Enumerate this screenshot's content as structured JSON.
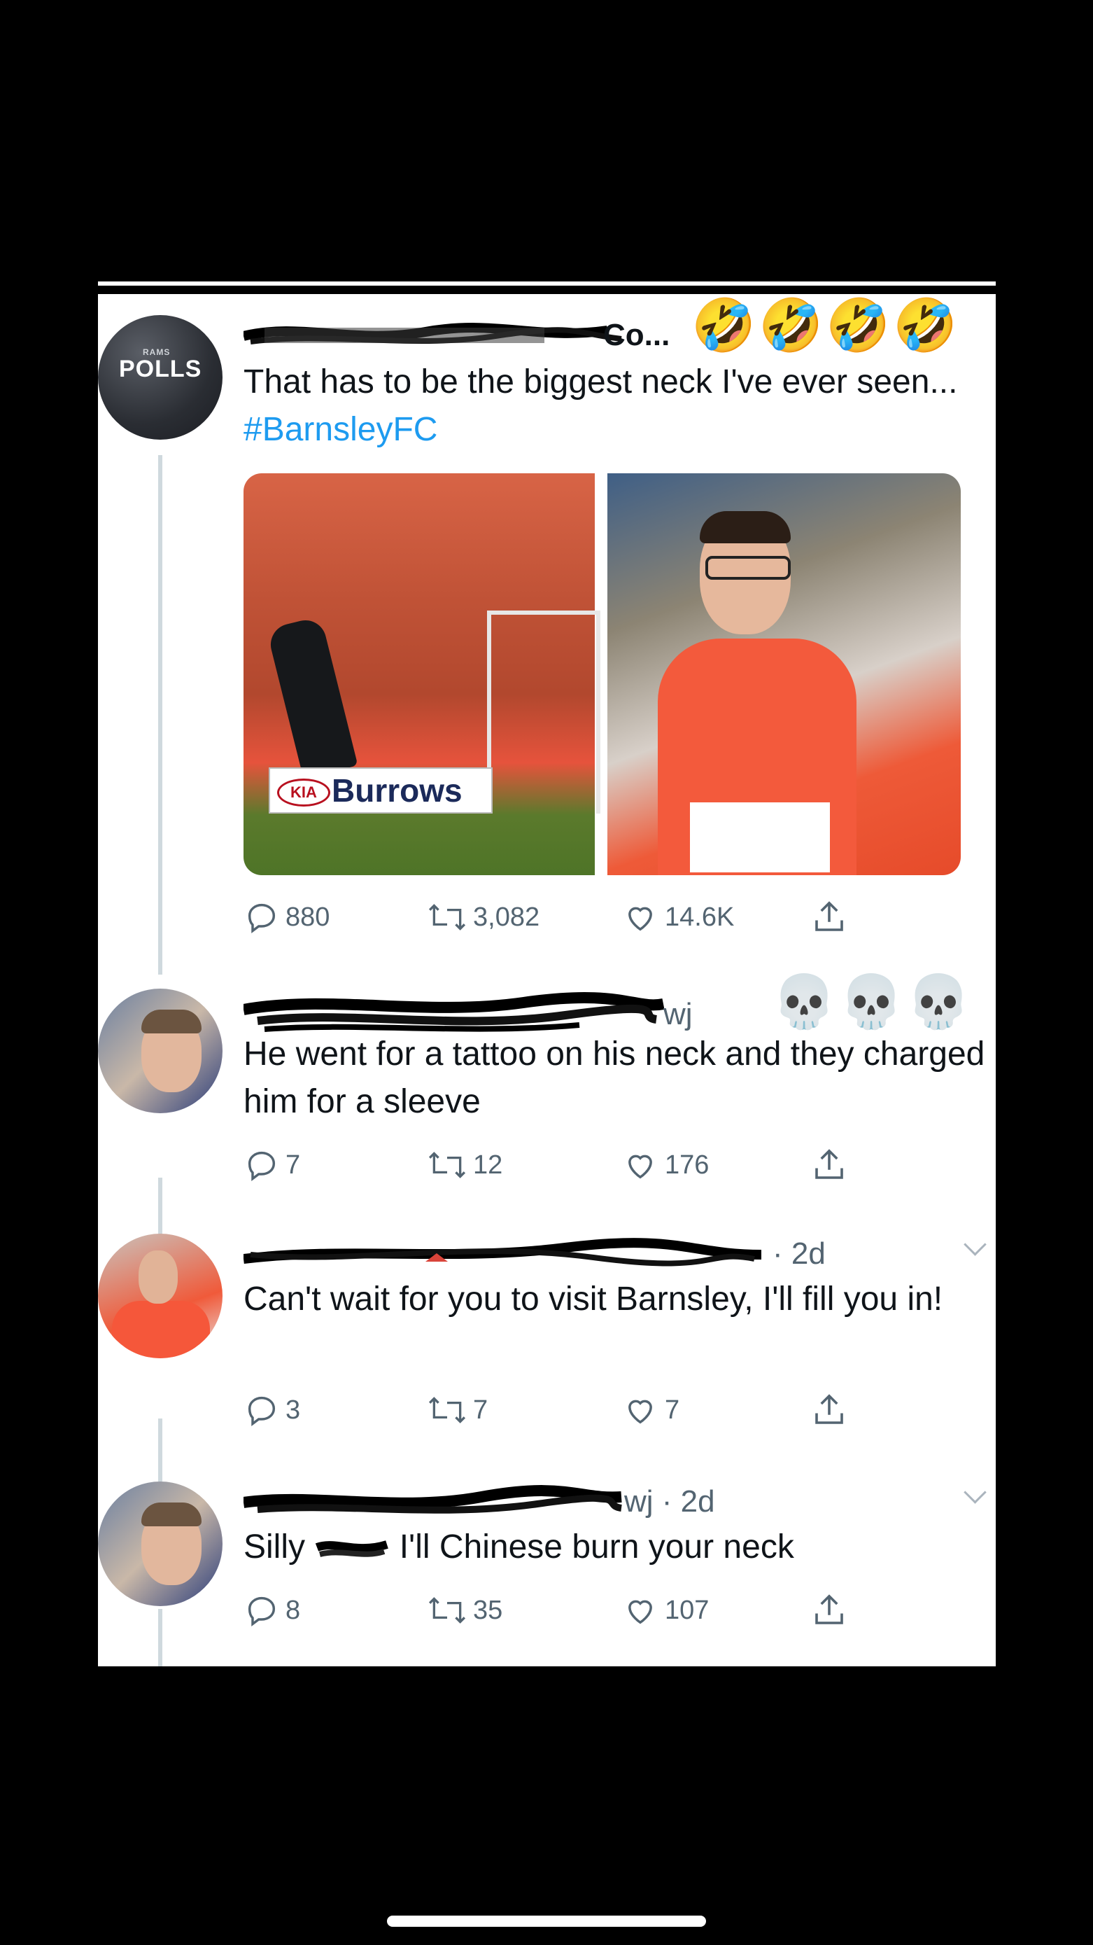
{
  "tweets": [
    {
      "avatar_small": "RAMS",
      "avatar_big": "POLLS",
      "handle": "Co...",
      "emojis": "🤣🤣🤣🤣",
      "text": "That has to be the biggest neck I've ever seen...",
      "hashtag": "#BarnsleyFC",
      "media": {
        "left_sign_brand": "KIA",
        "left_sign_text": "Burrows"
      },
      "replies": "880",
      "retweets": "3,082",
      "likes": "14.6K"
    },
    {
      "handle": "wj",
      "emojis": "💀💀💀 💀",
      "text": "He went for a tattoo on his neck and they charged him for a sleeve",
      "replies": "7",
      "retweets": "12",
      "likes": "176"
    },
    {
      "handle": "· 2d",
      "text": "Can't wait for you to visit Barnsley, I'll fill you in!",
      "replies": "3",
      "retweets": "7",
      "likes": "7"
    },
    {
      "handle": "wj · 2d",
      "text_start": "Silly",
      "text_end": "I'll Chinese burn your neck",
      "replies": "8",
      "retweets": "35",
      "likes": "107"
    }
  ],
  "icons": [
    "reply-icon",
    "retweet-icon",
    "like-icon",
    "share-icon",
    "chevron-down-icon"
  ]
}
